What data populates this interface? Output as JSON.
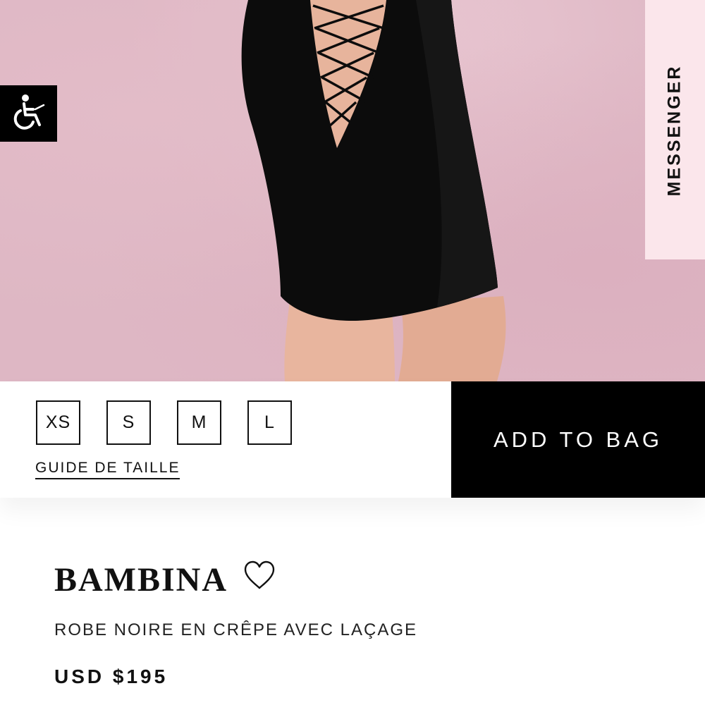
{
  "accessibility": {
    "icon": "wheelchair-icon"
  },
  "messenger": {
    "label": "MESSENGER"
  },
  "sizes": {
    "options": [
      "XS",
      "S",
      "M",
      "L"
    ],
    "guide_label": "GUIDE DE TAILLE"
  },
  "cart": {
    "add_label": "ADD TO BAG"
  },
  "product": {
    "name": "BAMBINA",
    "wishlist_icon": "heart-outline-icon",
    "description": "ROBE NOIRE EN CRÊPE AVEC LAÇAGE",
    "price": "USD $195"
  },
  "colors": {
    "accent": "#000000",
    "hero_background": "#deb7c4",
    "messenger_tab": "#fbe6eb"
  }
}
